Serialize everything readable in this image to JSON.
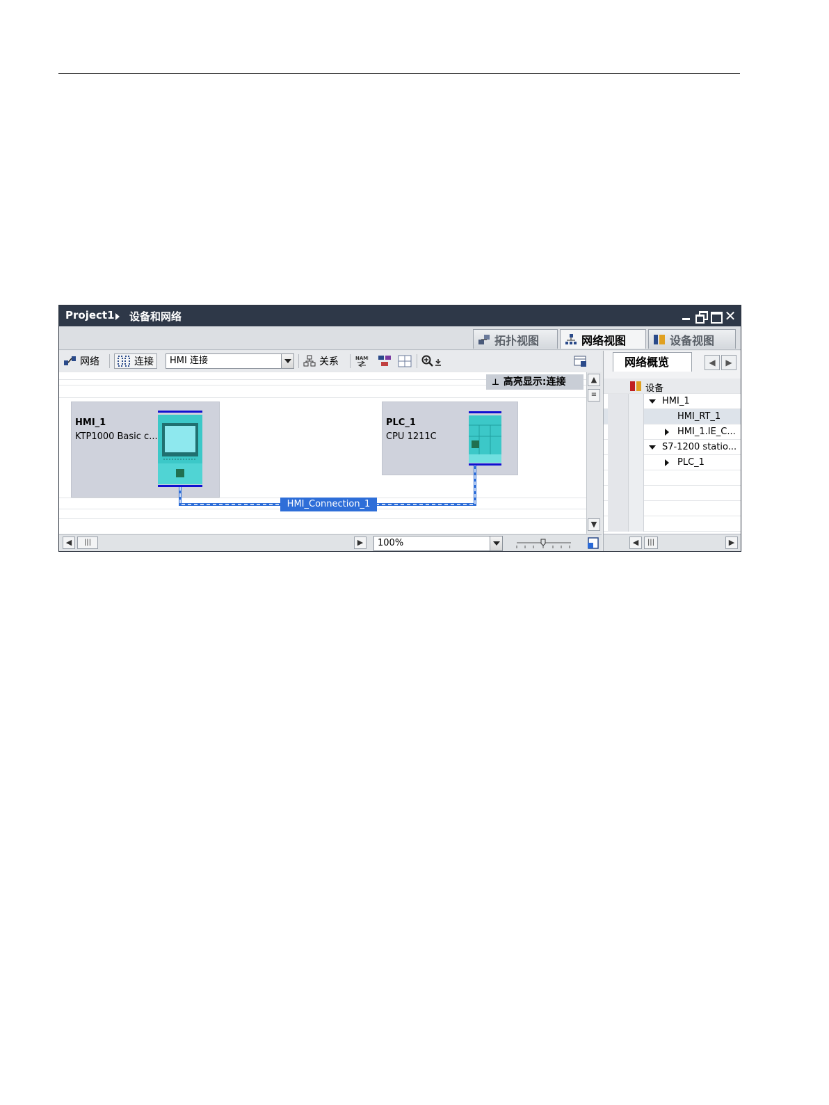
{
  "breadcrumb": {
    "project": "Project1",
    "section": "设备和网络"
  },
  "view_tabs": {
    "topology": "拓扑视图",
    "network": "网络视图",
    "device": "设备视图"
  },
  "toolbar": {
    "network_label": "网络",
    "connect_label": "连接",
    "connection_type": "HMI 连接",
    "relations_label": "关系"
  },
  "highlight": {
    "text": "高亮显示:连接"
  },
  "devices": {
    "hmi": {
      "name": "HMI_1",
      "type": "KTP1000 Basic c..."
    },
    "plc": {
      "name": "PLC_1",
      "type": "CPU 1211C"
    }
  },
  "connection": {
    "label": "HMI_Connection_1"
  },
  "status": {
    "zoom": "100%"
  },
  "overview": {
    "tab_label": "网络概览",
    "header": "设备",
    "rows": [
      "HMI_1",
      "HMI_RT_1",
      "HMI_1.IE_C...",
      "S7-1200 statio...",
      "PLC_1"
    ]
  },
  "colors": {
    "accent": "#2e6ed8",
    "title_bar": "#2e3848",
    "device_teal": "#3cc8c8",
    "bus": "#1010d0"
  }
}
